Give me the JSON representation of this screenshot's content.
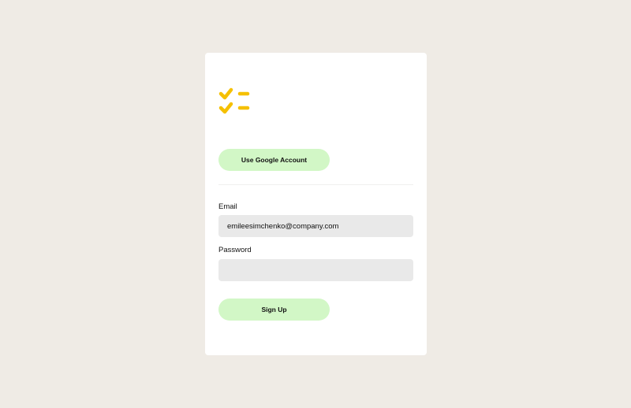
{
  "colors": {
    "background": "#efebe5",
    "card": "#ffffff",
    "accent_button": "#d2f7c6",
    "logo": "#f5c000",
    "input_background": "#e9e9e9"
  },
  "logo": {
    "icon": "checklist-icon"
  },
  "google_button": {
    "label": "Use Google Account"
  },
  "form": {
    "email": {
      "label": "Email",
      "value": "emileesimchenko@company.com"
    },
    "password": {
      "label": "Password",
      "value": ""
    },
    "submit_label": "Sign Up"
  }
}
